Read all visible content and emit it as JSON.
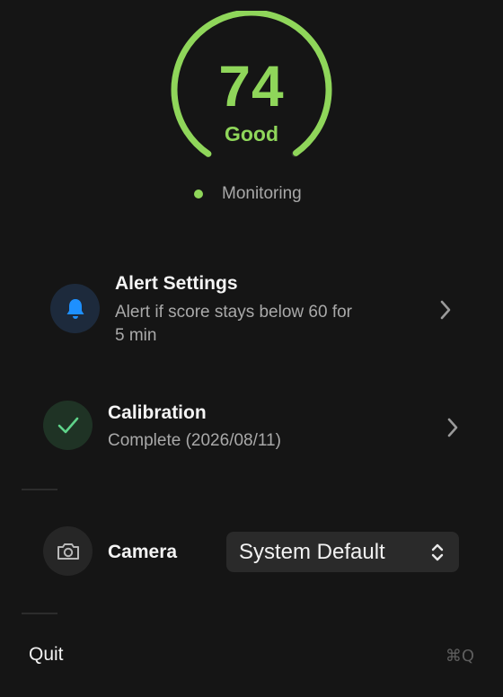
{
  "score": {
    "value": "74",
    "fraction": 0.74,
    "label": "Good"
  },
  "status": {
    "text": "Monitoring",
    "color": "#8fd65a"
  },
  "colors": {
    "accent_green": "#8fd65a",
    "bell_blue": "#1e90ff",
    "background": "#151515"
  },
  "alert_settings": {
    "title": "Alert Settings",
    "subtitle_line1": "Alert if score stays below 60 for",
    "subtitle_line2": "5 min",
    "icon": "bell-icon"
  },
  "calibration": {
    "title": "Calibration",
    "subtitle": "Complete (2026/08/11)",
    "icon": "checkmark-icon"
  },
  "camera": {
    "label": "Camera",
    "icon": "camera-icon",
    "selected": "System Default"
  },
  "quit": {
    "label": "Quit",
    "shortcut": "⌘Q"
  }
}
